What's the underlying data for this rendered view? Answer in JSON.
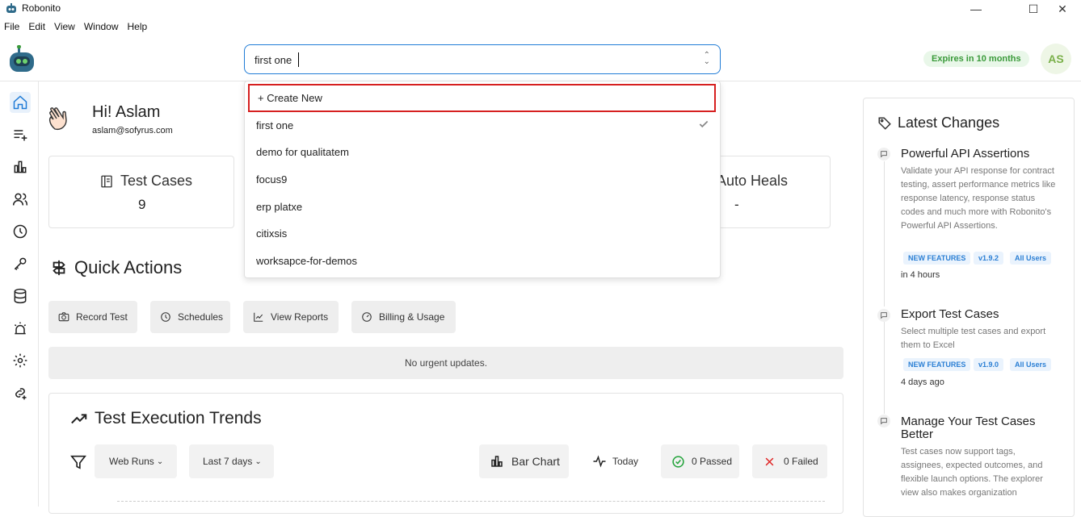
{
  "window": {
    "title": "Robonito",
    "minimize_label": "—",
    "maximize_label": "☐",
    "close_label": "✕"
  },
  "menu": [
    "File",
    "Edit",
    "View",
    "Window",
    "Help"
  ],
  "header": {
    "workspace_value": "first one",
    "expires_label": "Expires in 10 months",
    "avatar_initials": "AS"
  },
  "greeting": {
    "title": "Hi! Aslam",
    "email": "aslam@sofyrus.com"
  },
  "stats": [
    {
      "label": "Test Cases",
      "value": "9"
    },
    {
      "label": "Auto Heals",
      "value": "-"
    }
  ],
  "quick_actions": {
    "title": "Quick Actions",
    "buttons": [
      "Record Test",
      "Schedules",
      "View Reports",
      "Billing & Usage"
    ],
    "urgent_text": "No urgent updates."
  },
  "trends": {
    "title": "Test Execution Trends",
    "run_type": "Web Runs",
    "range": "Last 7 days",
    "chart_toggle": "Bar Chart",
    "today_label": "Today",
    "passed_label": "0 Passed",
    "failed_label": "0 Failed"
  },
  "latest_changes": {
    "title": "Latest Changes",
    "items": [
      {
        "title": "Powerful API Assertions",
        "desc": "Validate your API response for contract testing, assert performance metrics like response latency, response status codes and much more with Robonito's Powerful API Assertions.",
        "tags": [
          "NEW FEATURES",
          "v1.9.2",
          "All Users"
        ],
        "time": "in 4 hours"
      },
      {
        "title": "Export Test Cases",
        "desc": "Select multiple test cases and export them to Excel",
        "tags": [
          "NEW FEATURES",
          "v1.9.0",
          "All Users"
        ],
        "time": "4 days ago"
      },
      {
        "title": "Manage Your Test Cases Better",
        "desc": "Test cases now support tags, assignees, expected outcomes, and flexible launch options. The explorer view also makes organization",
        "tags": [],
        "time": ""
      }
    ]
  },
  "dropdown": {
    "create_label": "+ Create New",
    "options": [
      "first one",
      "demo for qualitatem",
      "focus9",
      "erp platxe",
      "citixsis",
      "worksapce-for-demos"
    ],
    "selected": "first one"
  },
  "colors": {
    "accent": "#1f7bd6",
    "highlight_border": "#d62020",
    "expires_bg": "#e9f7e9",
    "expires_text": "#3a9a3a"
  }
}
